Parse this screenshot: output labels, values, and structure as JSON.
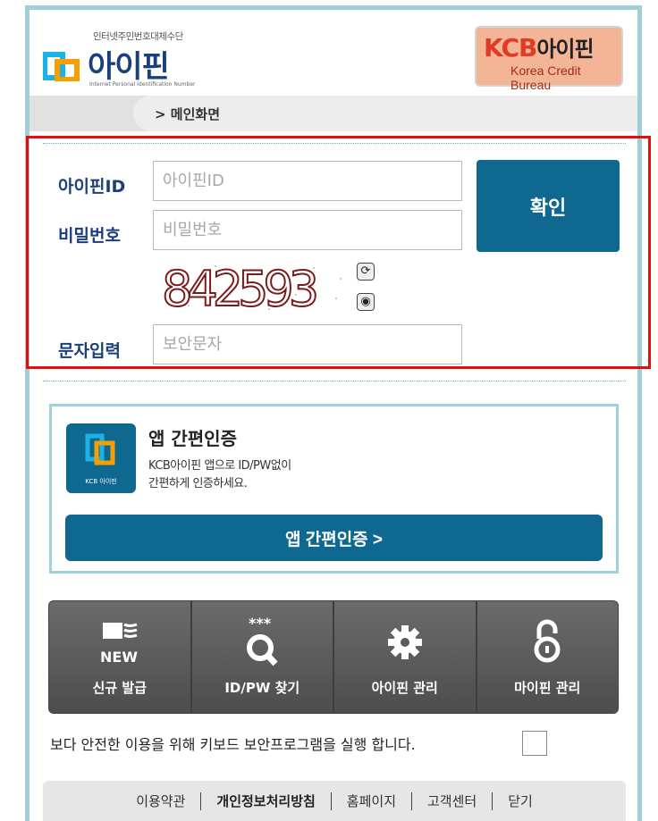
{
  "header": {
    "logo_subtitle": "인터넷주민번호대체수단",
    "logo_text": "아이핀",
    "logo_tagline": "Internet Personal Identification Number",
    "kcb_brand": "KCB",
    "kcb_brand_suffix": "아이핀",
    "kcb_subtitle": "Korea Credit Bureau"
  },
  "breadcrumb": {
    "label": "> 메인화면"
  },
  "login": {
    "id_label": "아이핀ID",
    "id_placeholder": "아이핀ID",
    "pw_label": "비밀번호",
    "pw_placeholder": "비밀번호",
    "captcha_value": "842593",
    "captcha_label": "문자입력",
    "captcha_placeholder": "보안문자",
    "confirm_label": "확인"
  },
  "app_auth": {
    "title": "앱 간편인증",
    "desc_line1": "KCB아이핀 앱으로 ID/PW없이",
    "desc_line2": "간편하게 인증하세요.",
    "icon_label": "KCB 아이핀",
    "button_label": "앱 간편인증 >"
  },
  "menu": [
    {
      "label": "신규 발급",
      "icon": "new-card-icon"
    },
    {
      "label": "ID/PW 찾기",
      "icon": "search-icon"
    },
    {
      "label": "아이핀 관리",
      "icon": "gear-icon"
    },
    {
      "label": "마이핀 관리",
      "icon": "lock-icon"
    }
  ],
  "menu_new_text": "NEW",
  "menu_stars": "***",
  "keyboard_security": {
    "text": "보다 안전한 이용을 위해 키보드 보안프로그램을 실행 합니다."
  },
  "footer": {
    "links": [
      "이용약관",
      "개인정보처리방침",
      "홈페이지",
      "고객센터",
      "닫기"
    ]
  },
  "colors": {
    "primary": "#0f6890",
    "frame": "#9fcfd6",
    "highlight": "#e01010",
    "label": "#1b3f7c"
  }
}
